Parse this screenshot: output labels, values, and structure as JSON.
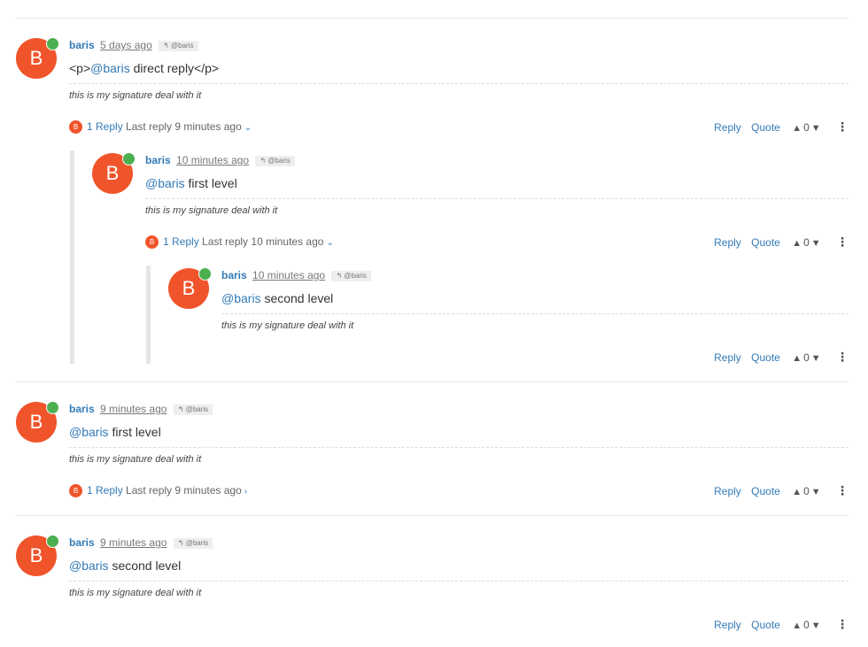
{
  "posts": [
    {
      "avatar_letter": "B",
      "username": "baris",
      "timestamp": "5 days ago",
      "parent_tag": "@baris",
      "reply_icon": "reply-arrow-icon",
      "content_prefix": "<p>",
      "content_mention": "@baris",
      "content_text": " direct reply</p>",
      "signature": "this is my signature deal with it",
      "replies_label": "1 Reply",
      "last_reply": "Last reply 9 minutes ago",
      "replies_chevron": "chevron-down-icon"
    },
    {
      "avatar_letter": "B",
      "username": "baris",
      "timestamp": "10 minutes ago",
      "parent_tag": "@baris",
      "reply_icon": "reply-arrow-icon",
      "content_mention": "@baris",
      "content_text": " first level",
      "signature": "this is my signature deal with it",
      "replies_label": "1 Reply",
      "last_reply": "Last reply 10 minutes ago",
      "replies_chevron": "chevron-down-icon"
    },
    {
      "avatar_letter": "B",
      "username": "baris",
      "timestamp": "10 minutes ago",
      "parent_tag": "@baris",
      "reply_icon": "reply-arrow-icon",
      "content_mention": "@baris",
      "content_text": " second level",
      "signature": "this is my signature deal with it"
    },
    {
      "avatar_letter": "B",
      "username": "baris",
      "timestamp": "9 minutes ago",
      "parent_tag": "@baris",
      "reply_icon": "reply-arrow-icon",
      "content_mention": "@baris",
      "content_text": " first level",
      "signature": "this is my signature deal with it",
      "replies_label": "1 Reply",
      "last_reply": "Last reply 9 minutes ago",
      "replies_chevron": "chevron-right-icon"
    },
    {
      "avatar_letter": "B",
      "username": "baris",
      "timestamp": "9 minutes ago",
      "parent_tag": "@baris",
      "reply_icon": "reply-arrow-icon",
      "content_mention": "@baris",
      "content_text": " second level",
      "signature": "this is my signature deal with it"
    }
  ],
  "actions": {
    "reply_label": "Reply",
    "quote_label": "Quote",
    "vote_count": "0",
    "upvote_icon": "chevron-up-icon",
    "downvote_icon": "chevron-down-icon",
    "menu_icon": "vertical-ellipsis-icon"
  },
  "colors": {
    "avatar": "#f0542b",
    "online": "#4caf50",
    "link": "#337ab7"
  }
}
